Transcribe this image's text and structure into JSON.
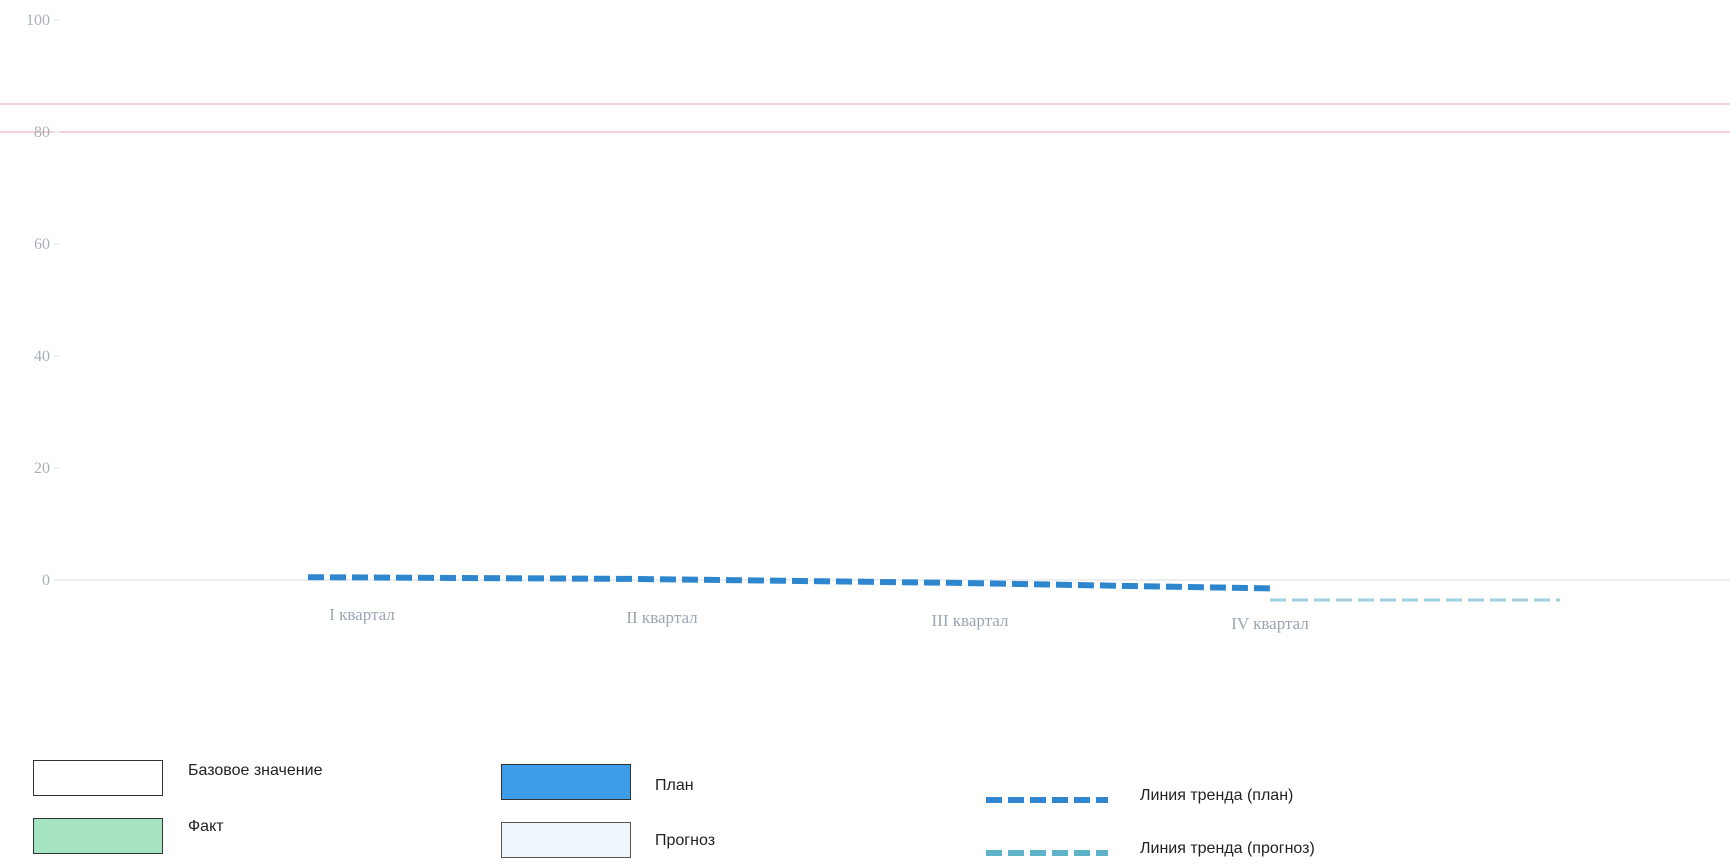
{
  "colors": {
    "baseline": "#ffffff",
    "plan": "#3d9de6",
    "fact": "#a6e3c0",
    "forecast": "#eef6fb",
    "trend_plan": "#2e86cf",
    "trend_forecast": "#5fb3c9",
    "ref_line": "#e8a0a8",
    "grid": "#d8dde2"
  },
  "chart_data": {
    "type": "bar",
    "categories": [
      "I квартал",
      "II квартал",
      "III квартал",
      "IV квартал"
    ],
    "yticks": [
      "0",
      "20",
      "40",
      "60",
      "80",
      "100"
    ],
    "ylim": [
      0,
      100
    ],
    "grid": false,
    "reference_lines": [
      80,
      85
    ],
    "series": [
      {
        "name": "Базовое значение",
        "values": [
          0,
          0,
          0,
          0
        ]
      },
      {
        "name": "План",
        "values": [
          0,
          0,
          0,
          0
        ]
      },
      {
        "name": "Факт",
        "values": [
          0,
          0,
          0,
          0
        ]
      },
      {
        "name": "Прогноз",
        "values": [
          0,
          0,
          0,
          0
        ]
      }
    ],
    "trend_lines": [
      {
        "name": "Линия тренда (план)",
        "values": [
          0.5,
          0.2,
          -0.5,
          -1.5
        ]
      },
      {
        "name": "Линия тренда (прогноз)",
        "values": [
          0,
          0,
          0,
          0
        ]
      }
    ],
    "legend_position": "bottom"
  },
  "legend": {
    "baseline": "Базовое значение",
    "plan": "План",
    "fact": "Факт",
    "forecast": "Прогноз",
    "trend_plan": "Линия тренда (план)",
    "trend_forecast": "Линия тренда (прогноз)"
  }
}
